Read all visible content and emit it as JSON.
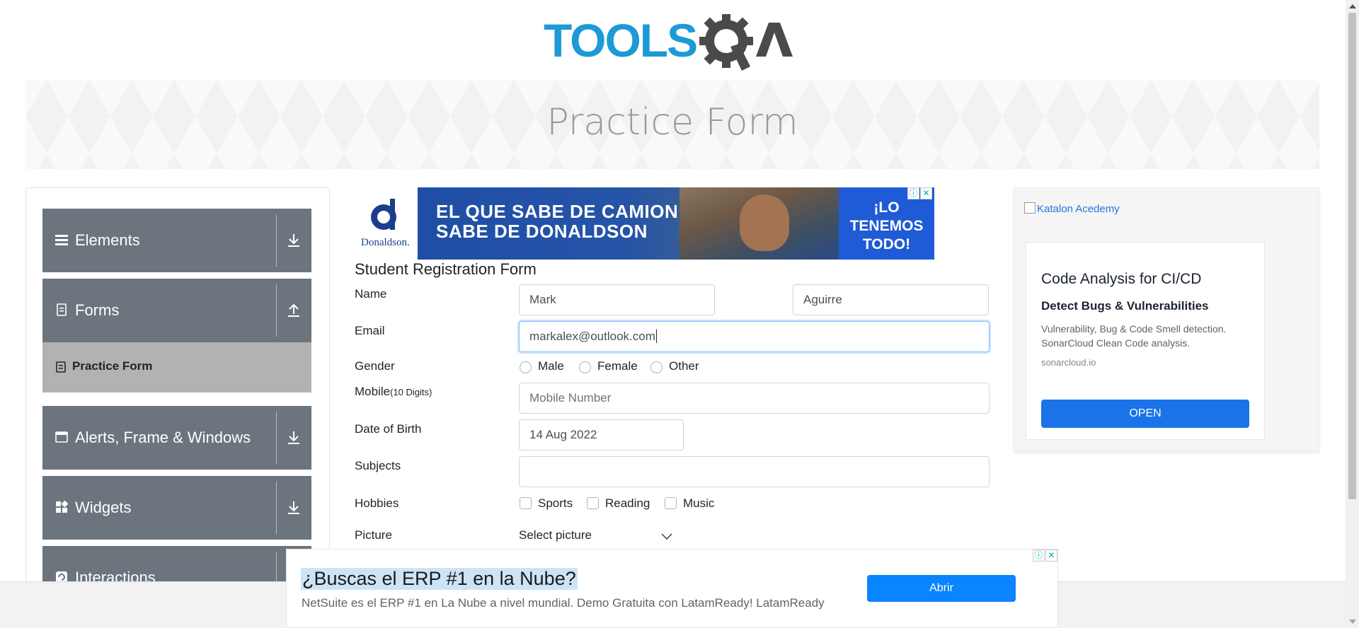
{
  "header": {
    "logo_text": "TOOLSQA"
  },
  "banner": {
    "title": "Practice Form"
  },
  "sidebar": {
    "groups": [
      {
        "label": "Elements",
        "icon": "hamburger-icon"
      },
      {
        "label": "Forms",
        "icon": "document-icon",
        "expanded": true
      },
      {
        "label": "Alerts, Frame & Windows",
        "icon": "window-icon"
      },
      {
        "label": "Widgets",
        "icon": "grid-icon"
      },
      {
        "label": "Interactions",
        "icon": "refresh-icon"
      }
    ],
    "active_item": "Practice Form"
  },
  "top_ad": {
    "brand": "Donaldson.",
    "headline_1": "EL QUE SABE DE CAMIONES",
    "headline_2": "SABE DE DONALDSON",
    "right_1": "¡LO",
    "right_2": "TENEMOS",
    "right_3": "TODO!"
  },
  "form": {
    "title": "Student Registration Form",
    "name_label": "Name",
    "first_name": "Mark",
    "last_name": "Aguirre",
    "email_label": "Email",
    "email": "markalex@outlook.com",
    "gender_label": "Gender",
    "gender_options": [
      "Male",
      "Female",
      "Other"
    ],
    "mobile_label": "Mobile",
    "mobile_hint": "(10 Digits)",
    "mobile_placeholder": "Mobile Number",
    "dob_label": "Date of Birth",
    "dob": "14 Aug 2022",
    "subjects_label": "Subjects",
    "subjects": "",
    "hobbies_label": "Hobbies",
    "hobbies": [
      "Sports",
      "Reading",
      "Music"
    ],
    "picture_label": "Picture",
    "picture_button": "Select picture"
  },
  "right_ad": {
    "image_alt": "Katalon Acedemy",
    "title": "Code Analysis for CI/CD",
    "subtitle": "Detect Bugs & Vulnerabilities",
    "description": "Vulnerability, Bug & Code Smell detection. SonarCloud Clean Code analysis.",
    "url": "sonarcloud.io",
    "cta": "OPEN"
  },
  "bottom_ad": {
    "headline": "¿Buscas el ERP #1 en la Nube?",
    "body": "NetSuite es el ERP #1 en La Nube a nivel mundial. Demo Gratuita con LatamReady! LatamReady",
    "cta": "Abrir"
  },
  "colors": {
    "accent_blue": "#1a9ad6",
    "sidebar_bg": "#6c757d",
    "active_bg": "#b2b2b2",
    "focus_border": "#80bdff"
  }
}
